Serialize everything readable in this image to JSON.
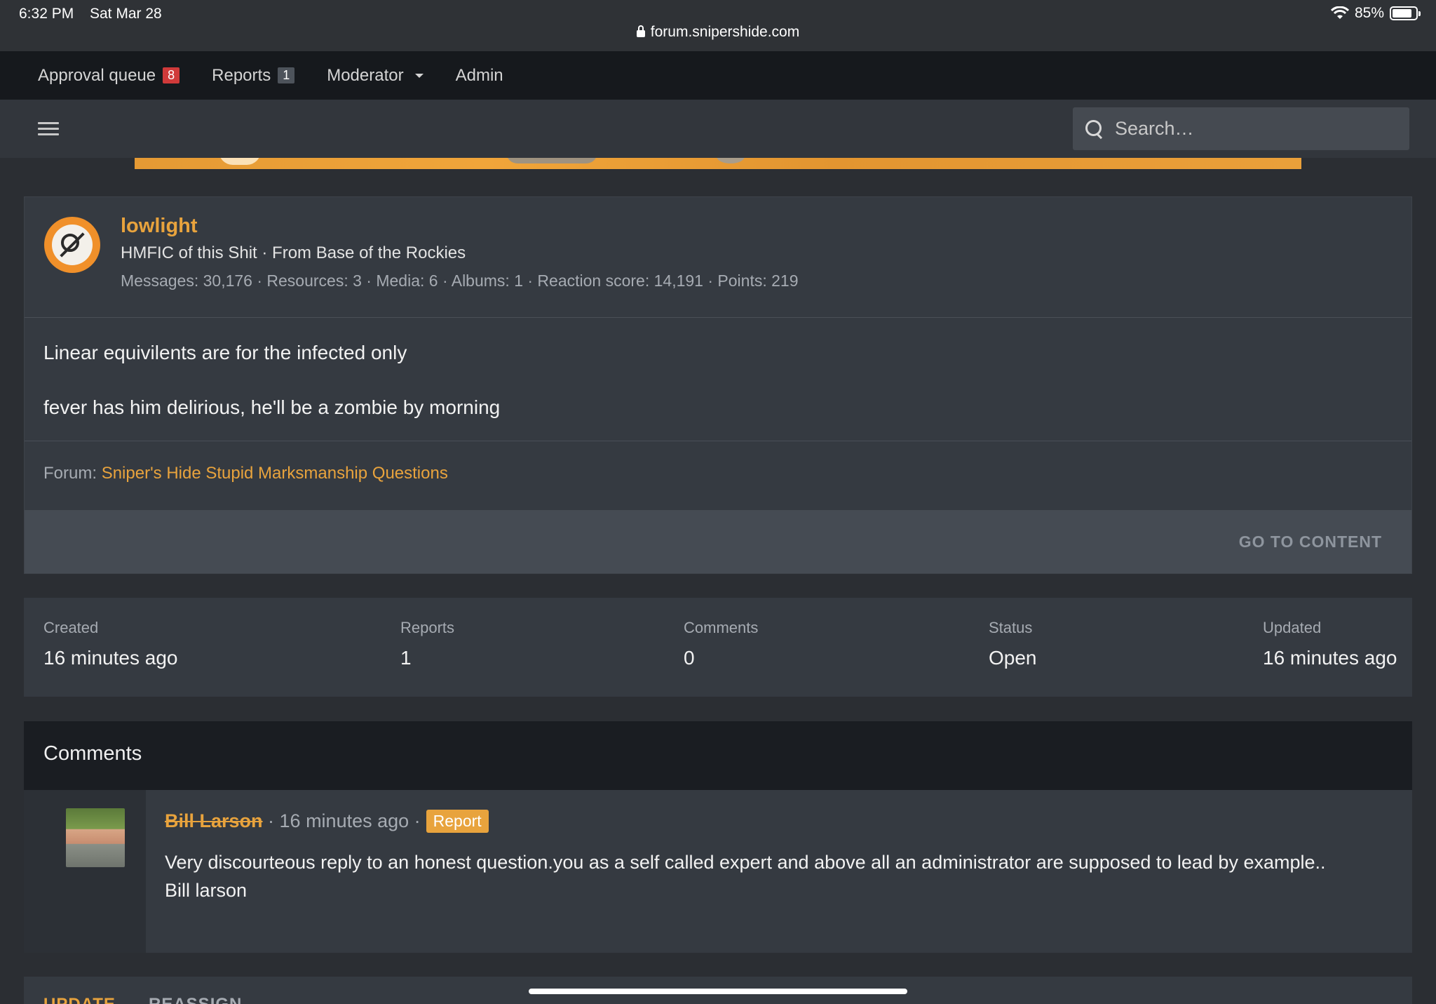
{
  "status_bar": {
    "time": "6:32 PM",
    "date": "Sat Mar 28",
    "battery": "85%",
    "url": "forum.snipershide.com"
  },
  "mod_bar": {
    "items": [
      {
        "label": "Approval queue",
        "badge": "8"
      },
      {
        "label": "Reports",
        "badge": "1"
      },
      {
        "label": "Moderator"
      },
      {
        "label": "Admin"
      }
    ]
  },
  "search": {
    "placeholder": "Search…"
  },
  "post": {
    "username": "lowlight",
    "user_title": "HMFIC of this Shit · From Base of the Rockies",
    "user_stats": "Messages: 30,176 · Resources: 3 · Media: 6 · Albums: 1 · Reaction score: 14,191 · Points: 219",
    "body": [
      "Linear equivilents are for the infected only",
      "fever has him delirious, he'll be a zombie by morning"
    ],
    "forum_label": "Forum:",
    "forum_link": "Sniper's Hide Stupid Marksmanship Questions",
    "go_to_content": "GO TO CONTENT"
  },
  "stats": [
    {
      "label": "Created",
      "value": "16 minutes ago"
    },
    {
      "label": "Reports",
      "value": "1"
    },
    {
      "label": "Comments",
      "value": "0"
    },
    {
      "label": "Status",
      "value": "Open"
    },
    {
      "label": "Updated",
      "value": "16 minutes ago"
    }
  ],
  "comments": {
    "title": "Comments",
    "items": [
      {
        "author": "Bill Larson",
        "time": "16 minutes ago",
        "report_label": "Report",
        "text_line1": "Very discourteous reply to an honest question.you as a self called expert and above all an administrator are supposed to lead by example..",
        "text_line2": "Bill larson"
      }
    ]
  },
  "bottom_tabs": [
    "UPDATE",
    "REASSIGN"
  ],
  "colors": {
    "accent": "#e8a33d",
    "badge_red": "#d03a3a"
  }
}
